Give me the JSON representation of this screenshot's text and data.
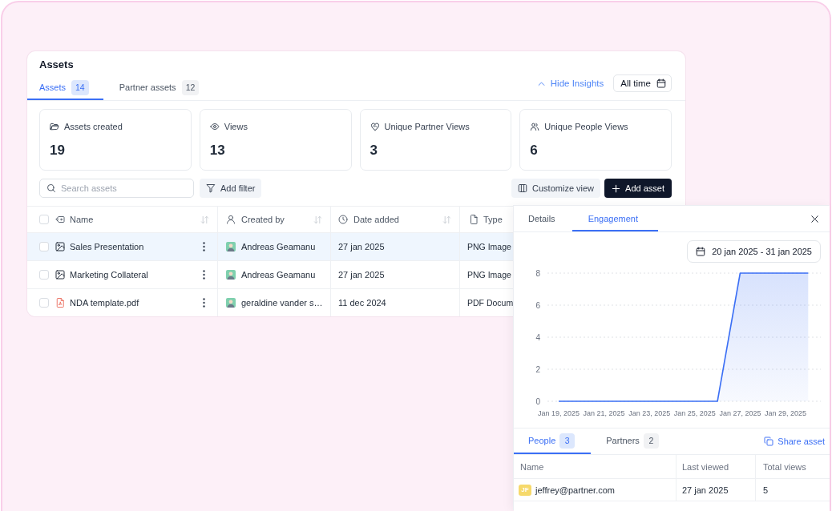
{
  "header": {
    "title": "Assets"
  },
  "tabs": [
    {
      "label": "Assets",
      "count": "14",
      "selected": true
    },
    {
      "label": "Partner assets",
      "count": "12",
      "selected": false
    }
  ],
  "insights_toggle": {
    "label": "Hide Insights",
    "expanded": true
  },
  "date_filter": {
    "label": "All time"
  },
  "stats": [
    {
      "kind": "created",
      "label": "Assets created",
      "value": "19"
    },
    {
      "kind": "views",
      "label": "Views",
      "value": "13"
    },
    {
      "kind": "partners",
      "label": "Unique Partner Views",
      "value": "3"
    },
    {
      "kind": "people",
      "label": "Unique People Views",
      "value": "6"
    }
  ],
  "toolbar": {
    "search": {
      "placeholder": "Search assets"
    },
    "filter_button": "Add filter",
    "customize_button": "Customize view",
    "add_button": "Add asset"
  },
  "table": {
    "select_all": {
      "checked": false
    },
    "columns": [
      {
        "kind": "name",
        "label": "Name",
        "sortable": true
      },
      {
        "kind": "person",
        "label": "Created by",
        "sortable": true
      },
      {
        "kind": "date",
        "label": "Date added",
        "sortable": true
      },
      {
        "kind": "file",
        "label": "Type",
        "sortable": false
      }
    ],
    "rows": [
      {
        "selected": true,
        "checked": false,
        "kind": "image",
        "name": "Sales Presentation",
        "created_by": "Andreas Geamanu",
        "date_added": "27 jan 2025",
        "type": "PNG Image"
      },
      {
        "selected": false,
        "checked": false,
        "kind": "image",
        "name": "Marketing Collateral",
        "created_by": "Andreas Geamanu",
        "date_added": "27 jan 2025",
        "type": "PNG Image"
      },
      {
        "selected": false,
        "checked": false,
        "kind": "pdf",
        "name": "NDA template.pdf",
        "created_by": "geraldine vander s…",
        "date_added": "11 dec 2024",
        "type": "PDF Docum"
      }
    ]
  },
  "panel": {
    "tabs": [
      {
        "label": "Details",
        "selected": false
      },
      {
        "label": "Engagement",
        "selected": true
      }
    ],
    "date_range": "20 jan 2025 - 31 jan 2025",
    "chart_data": {
      "type": "area",
      "categories": [
        "Jan 19, 2025",
        null,
        "Jan 21, 2025",
        null,
        "Jan 23, 2025",
        null,
        "Jan 25, 2025",
        null,
        "Jan 27, 2025",
        null,
        "Jan 29, 2025",
        null
      ],
      "ylim": [
        0,
        8
      ],
      "yticks": [
        0,
        2,
        4,
        6,
        8
      ],
      "grid": true,
      "series": [
        {
          "color": "#3b6ff5",
          "values": [
            0,
            0,
            0,
            0,
            0,
            0,
            0,
            0,
            8,
            8,
            8,
            8
          ]
        }
      ]
    },
    "viewer_tabs": [
      {
        "label": "People",
        "count": "3",
        "selected": true
      },
      {
        "label": "Partners",
        "count": "2",
        "selected": false
      }
    ],
    "share_link": "Share asset",
    "viewers": {
      "columns": [
        "Name",
        "Last viewed",
        "Total views"
      ],
      "rows": [
        {
          "initials": "JF",
          "color": "#f6d96b",
          "email": "jeffrey@partner.com",
          "last_viewed": "27 jan 2025",
          "total_views": "5"
        }
      ]
    }
  }
}
